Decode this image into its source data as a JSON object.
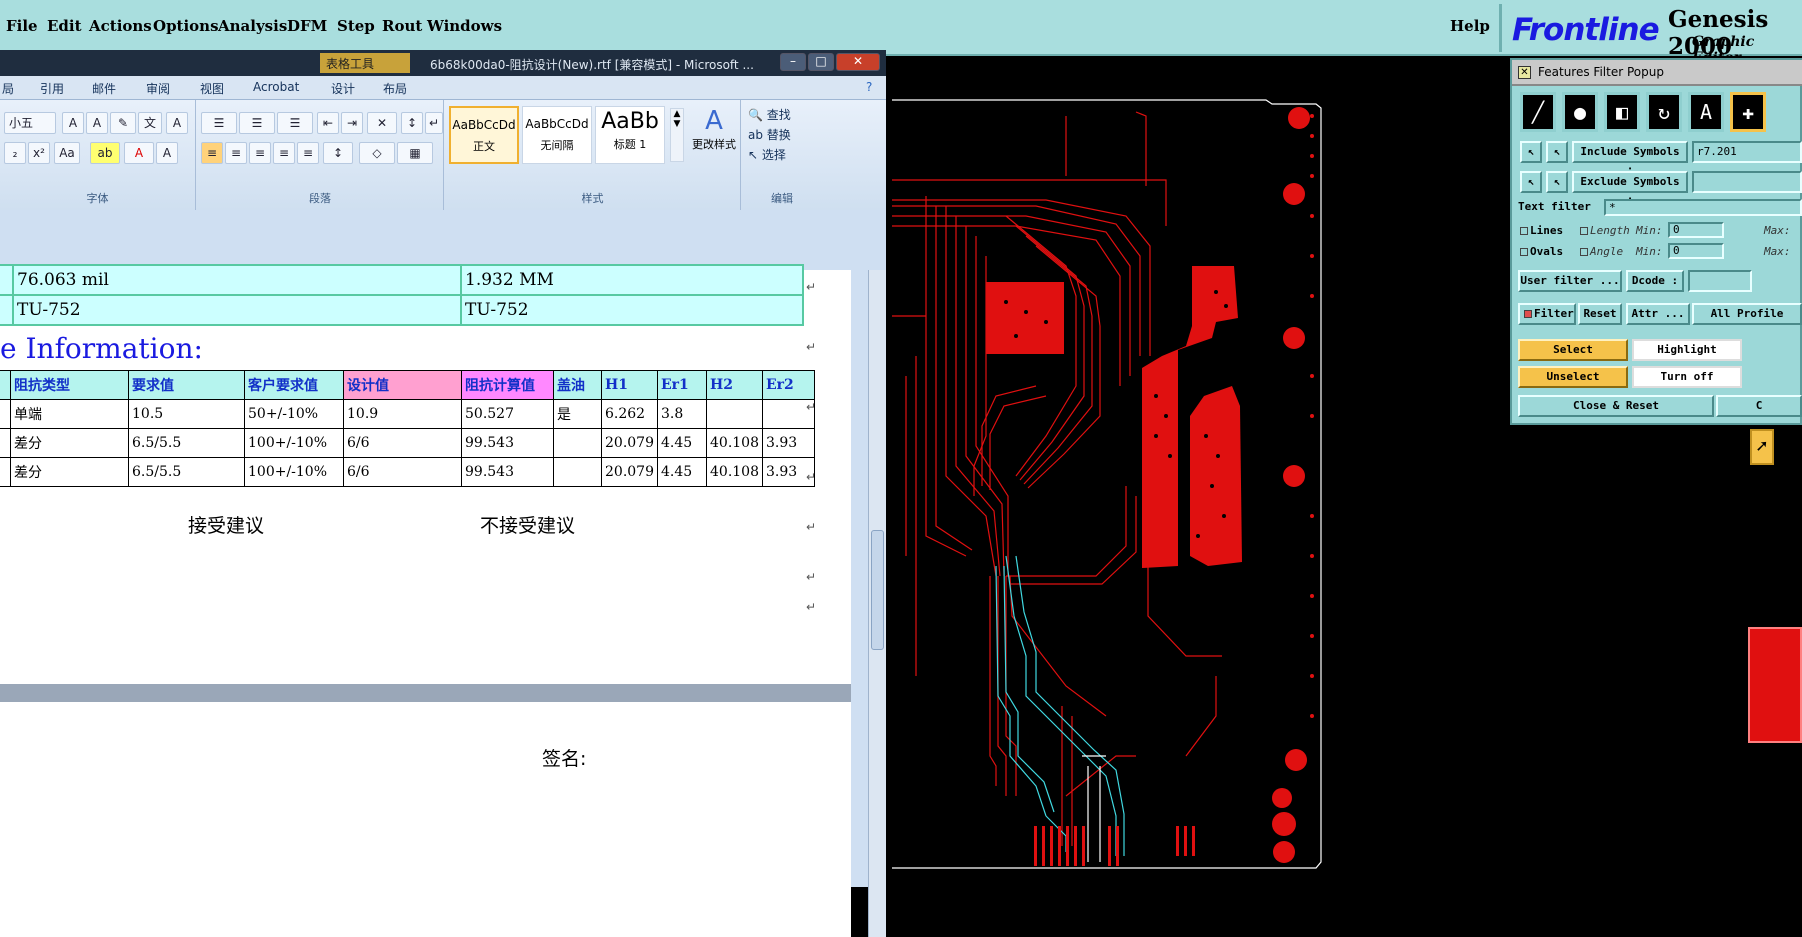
{
  "genesis": {
    "menu": [
      "File",
      "Edit",
      "Actions",
      "Options",
      "Analysis",
      "DFM",
      "Step",
      "Rout",
      "Windows"
    ],
    "help": "Help",
    "logo_text": "Frontline",
    "product": "Genesis 2000",
    "subtitle": "Graphic Editor"
  },
  "word": {
    "table_tools": "表格工具",
    "title": "6b68k00da0-阻抗设计(New).rtf [兼容模式] - Microsoft ...",
    "tabs": [
      "局",
      "引用",
      "邮件",
      "审阅",
      "视图",
      "Acrobat",
      "设计",
      "布局"
    ],
    "font_size": "小五",
    "group_labels": {
      "font": "字体",
      "paragraph": "段落",
      "styles": "样式",
      "editing": "编辑"
    },
    "styles": [
      {
        "preview": "AaBbCcDd",
        "name": "正文"
      },
      {
        "preview": "AaBbCcDd",
        "name": "无间隔"
      },
      {
        "preview": "AaBb",
        "name": "标题 1"
      }
    ],
    "change_styles": "更改样式",
    "editing": {
      "find": "查找",
      "replace": "替换",
      "select": "选择"
    },
    "top_table": [
      [
        "76.063 mil",
        "1.932 MM"
      ],
      [
        "TU-752",
        "TU-752"
      ]
    ],
    "info_heading": "e Information:",
    "imp_headers": [
      "阻抗类型",
      "要求值",
      "客户要求值",
      "设计值",
      "阻抗计算值",
      "盖油",
      "H1",
      "Er1",
      "H2",
      "Er2"
    ],
    "imp_rows": [
      [
        "单端",
        "10.5",
        "50+/-10%",
        "10.9",
        "50.527",
        "是",
        "6.262",
        "3.8",
        "",
        ""
      ],
      [
        "差分",
        "6.5/5.5",
        "100+/-10%",
        "6/6",
        "99.543",
        "",
        "20.079",
        "4.45",
        "40.108",
        "3.93"
      ],
      [
        "差分",
        "6.5/5.5",
        "100+/-10%",
        "6/6",
        "99.543",
        "",
        "20.079",
        "4.45",
        "40.108",
        "3.93"
      ]
    ],
    "accept": "接受建议",
    "reject": "不接受建议",
    "sign": "签名:"
  },
  "popup": {
    "title": "Features Filter Popup",
    "include_symbols": "Include Symbols :",
    "include_value": "r7.201",
    "exclude_symbols": "Exclude Symbols :",
    "text_filter": "Text filter",
    "text_value": "*",
    "lines": "Lines",
    "ovals": "Ovals",
    "length": "Length",
    "angle": "Angle",
    "min": "Min:",
    "max": "Max:",
    "min_value": "0",
    "user_filter": "User filter ...",
    "dcode": "Dcode :",
    "filter": "Filter",
    "reset": "Reset",
    "attr": "Attr ...",
    "all_profile": "All Profile",
    "select": "Select",
    "highlight": "Highlight",
    "unselect": "Unselect",
    "turn_off": "Turn off",
    "close_reset": "Close & Reset",
    "close_short": "C"
  },
  "colors": {
    "menubar": "#a9dede",
    "popup_bg": "#9cd8d8",
    "trace_red": "#e01010",
    "trace_cyan": "#40d8e0",
    "select_yellow": "#f5c24a"
  }
}
